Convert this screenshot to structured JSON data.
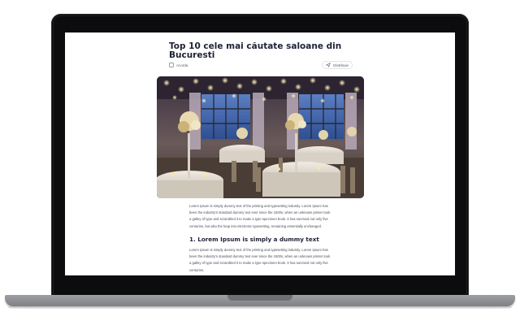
{
  "article": {
    "title": "Top 10 cele mai căutate saloane din Bucuresti",
    "save_label": "Acorda",
    "share_label": "Distribuie",
    "hero_alt": "Elegant banquet hall with round tables, white tablecloths, chiavari chairs, floral centerpieces and hanging string lights",
    "paragraph_1": "Lorem Ipsum is simply dummy text of the printing and typesetting industry. Lorem Ipsum has been the industry's standard dummy text ever since the 1500s, when an unknown printer took a galley of type and scrambled it to make a type specimen book. It has survived not only five centuries, but also the leap into electronic typesetting, remaining essentially unchanged.",
    "section_heading": "1. Lorem Ipsum is simply a dummy text",
    "paragraph_2": "Lorem Ipsum is simply dummy text of the printing and typesetting industry. Lorem Ipsum has been the industry's standard dummy text ever since the 1500s, when an unknown printer took a galley of type and scrambled it to make a type specimen book. It has survived not only five centuries."
  },
  "icons": {
    "save": "bookmark-icon",
    "share": "share-arrow-icon"
  },
  "colors": {
    "title": "#1e2235",
    "body_text": "#4a4e5a",
    "laptop_bezel": "#0c0c0e",
    "laptop_base": "#8e9095"
  }
}
